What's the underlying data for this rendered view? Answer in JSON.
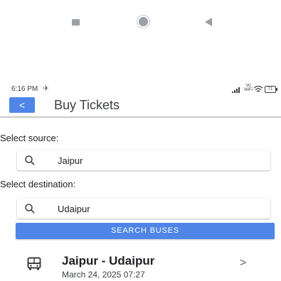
{
  "statusbar": {
    "time": "6:16 PM",
    "plane_glyph": "✈",
    "vowifi_top": "Vo",
    "vowifi_bottom": "WiFi",
    "battery": "71"
  },
  "appbar": {
    "back_glyph": "<",
    "title": "Buy Tickets"
  },
  "source": {
    "label": "Select source:",
    "value": "Jaipur",
    "icon": "search-icon"
  },
  "destination": {
    "label": "Select destination:",
    "value": "Udaipur",
    "icon": "search-icon"
  },
  "search_button": {
    "label": "SEARCH BUSES"
  },
  "results": [
    {
      "route": "Jaipur - Udaipur",
      "datetime": "March 24, 2025 07:27",
      "icon": "bus-icon",
      "chevron": ">"
    }
  ],
  "colors": {
    "accent": "#4f85e6",
    "nav_icon": "#9aa0a6"
  }
}
